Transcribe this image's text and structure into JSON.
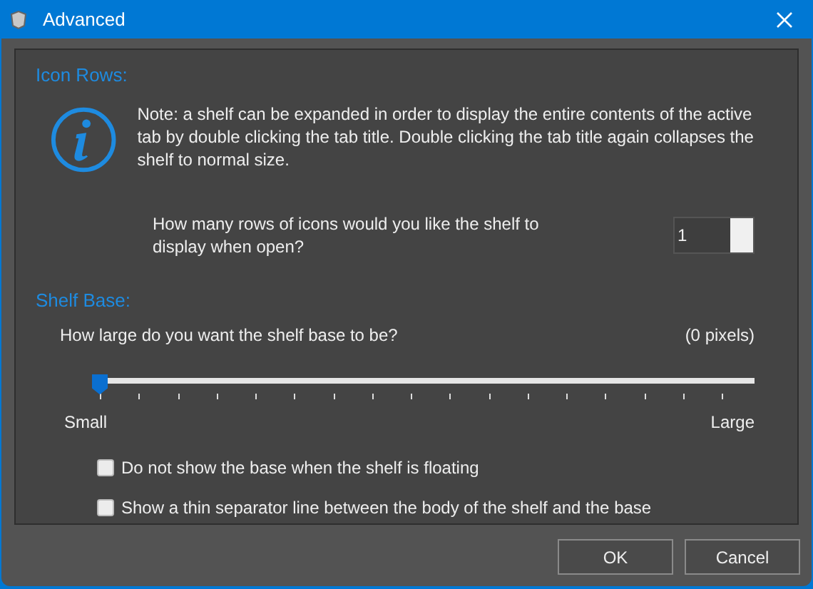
{
  "window": {
    "title": "Advanced"
  },
  "icon_rows": {
    "heading": "Icon Rows:",
    "note": "Note: a shelf can be expanded in order to display the entire contents of the active tab by double clicking the tab title. Double clicking the tab title again collapses the shelf to normal size.",
    "question": "How many rows of icons would you like the shelf to display when open?",
    "rows_value": "1"
  },
  "shelf_base": {
    "heading": "Shelf Base:",
    "question": "How large do you want the shelf base to be?",
    "reading": "(0 pixels)",
    "level": 0,
    "min_label": "Small",
    "max_label": "Large",
    "options": [
      {
        "label": "Do not show the base when the shelf is floating",
        "checked": false
      },
      {
        "label": "Show a thin separator line between the body of the shelf and the base",
        "checked": false
      }
    ]
  },
  "buttons": [
    "OK",
    "Cancel"
  ]
}
